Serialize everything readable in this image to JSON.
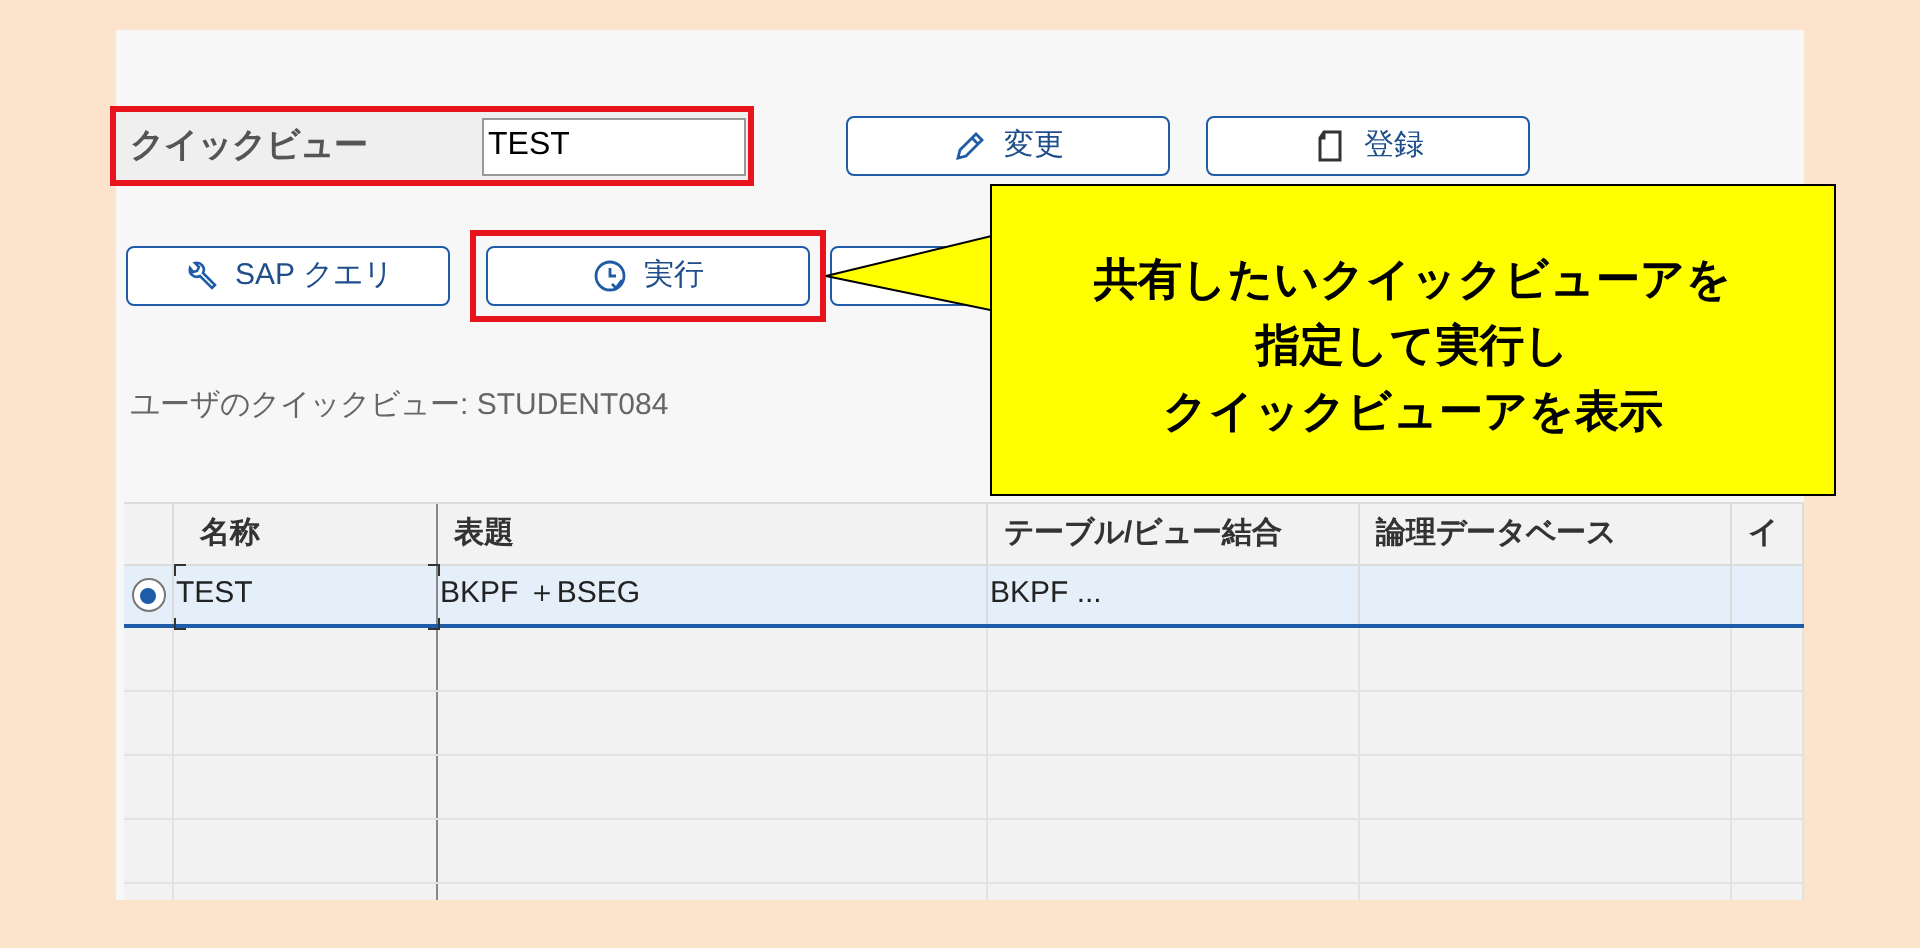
{
  "quick_view": {
    "label": "クイックビュー",
    "value": "TEST",
    "highlighted": true
  },
  "buttons_top": [
    {
      "kind": "pencil",
      "label": "変更"
    },
    {
      "kind": "page",
      "label": "登録"
    }
  ],
  "buttons_row2": [
    {
      "kind": "wrench",
      "label": "SAP クエリ",
      "highlighted": false
    },
    {
      "kind": "clock",
      "label": "実行",
      "highlighted": true
    }
  ],
  "user_views_label": "ユーザのクイックビュー: STUDENT084",
  "callout": {
    "lines": [
      "共有したいクイックビューアを",
      "指定して実行し",
      "クイックビューアを表示"
    ]
  },
  "table": {
    "columns": [
      "名称",
      "表題",
      "テーブル/ビュー結合",
      "論理データベース",
      "イ"
    ],
    "rows": [
      {
        "selected": true,
        "cells": [
          {
            "text": "TEST",
            "focused": true
          },
          {
            "text": "BKPF ＋BSEG",
            "focused": false
          },
          {
            "text": "BKPF ...",
            "focused": false
          }
        ]
      }
    ]
  }
}
